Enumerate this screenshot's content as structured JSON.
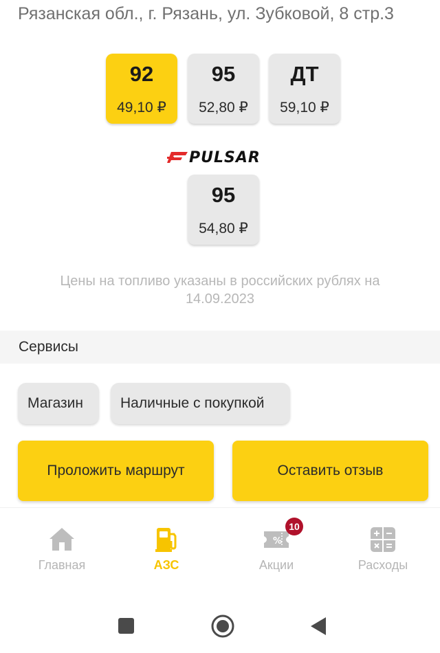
{
  "station": {
    "address": "Рязанская обл., г. Рязань, ул. Зубковой, 8 стр.3"
  },
  "fuels": [
    {
      "grade": "92",
      "price": "49,10 ₽",
      "selected": true
    },
    {
      "grade": "95",
      "price": "52,80 ₽",
      "selected": false
    },
    {
      "grade": "ДТ",
      "price": "59,10 ₽",
      "selected": false
    }
  ],
  "pulsar": {
    "brand": "PULSAR",
    "fuels": [
      {
        "grade": "95",
        "price": "54,80 ₽"
      }
    ]
  },
  "price_note": "Цены на топливо указаны в российских рублях на 14.09.2023",
  "services": {
    "title": "Сервисы",
    "items": [
      "Магазин",
      "Наличные с покупкой"
    ]
  },
  "actions": {
    "route": "Проложить маршрут",
    "review": "Оставить отзыв"
  },
  "tabbar": {
    "tabs": [
      {
        "label": "Главная",
        "icon": "home-icon",
        "active": false
      },
      {
        "label": "АЗС",
        "icon": "fuel-pump-icon",
        "active": true
      },
      {
        "label": "Акции",
        "icon": "coupon-icon",
        "active": false,
        "badge": "10"
      },
      {
        "label": "Расходы",
        "icon": "calculator-icon",
        "active": false
      }
    ]
  },
  "colors": {
    "accent": "#fcd012",
    "active_tab": "#f7c400",
    "badge": "#b0112b",
    "card_bg": "#e8e8e8"
  }
}
